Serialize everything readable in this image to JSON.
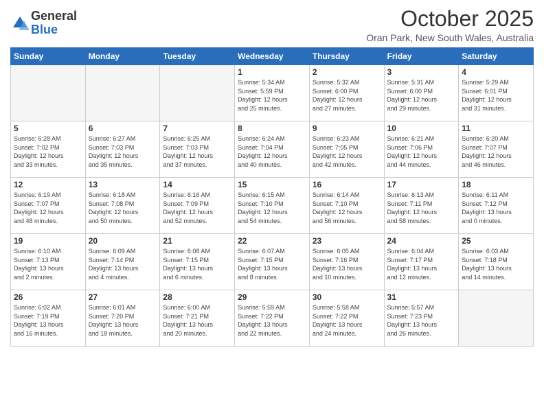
{
  "logo": {
    "general": "General",
    "blue": "Blue"
  },
  "title": "October 2025",
  "location": "Oran Park, New South Wales, Australia",
  "headers": [
    "Sunday",
    "Monday",
    "Tuesday",
    "Wednesday",
    "Thursday",
    "Friday",
    "Saturday"
  ],
  "weeks": [
    [
      {
        "day": "",
        "detail": ""
      },
      {
        "day": "",
        "detail": ""
      },
      {
        "day": "",
        "detail": ""
      },
      {
        "day": "1",
        "detail": "Sunrise: 5:34 AM\nSunset: 5:59 PM\nDaylight: 12 hours\nand 25 minutes."
      },
      {
        "day": "2",
        "detail": "Sunrise: 5:32 AM\nSunset: 6:00 PM\nDaylight: 12 hours\nand 27 minutes."
      },
      {
        "day": "3",
        "detail": "Sunrise: 5:31 AM\nSunset: 6:00 PM\nDaylight: 12 hours\nand 29 minutes."
      },
      {
        "day": "4",
        "detail": "Sunrise: 5:29 AM\nSunset: 6:01 PM\nDaylight: 12 hours\nand 31 minutes."
      }
    ],
    [
      {
        "day": "5",
        "detail": "Sunrise: 6:28 AM\nSunset: 7:02 PM\nDaylight: 12 hours\nand 33 minutes."
      },
      {
        "day": "6",
        "detail": "Sunrise: 6:27 AM\nSunset: 7:03 PM\nDaylight: 12 hours\nand 35 minutes."
      },
      {
        "day": "7",
        "detail": "Sunrise: 6:25 AM\nSunset: 7:03 PM\nDaylight: 12 hours\nand 37 minutes."
      },
      {
        "day": "8",
        "detail": "Sunrise: 6:24 AM\nSunset: 7:04 PM\nDaylight: 12 hours\nand 40 minutes."
      },
      {
        "day": "9",
        "detail": "Sunrise: 6:23 AM\nSunset: 7:05 PM\nDaylight: 12 hours\nand 42 minutes."
      },
      {
        "day": "10",
        "detail": "Sunrise: 6:21 AM\nSunset: 7:06 PM\nDaylight: 12 hours\nand 44 minutes."
      },
      {
        "day": "11",
        "detail": "Sunrise: 6:20 AM\nSunset: 7:07 PM\nDaylight: 12 hours\nand 46 minutes."
      }
    ],
    [
      {
        "day": "12",
        "detail": "Sunrise: 6:19 AM\nSunset: 7:07 PM\nDaylight: 12 hours\nand 48 minutes."
      },
      {
        "day": "13",
        "detail": "Sunrise: 6:18 AM\nSunset: 7:08 PM\nDaylight: 12 hours\nand 50 minutes."
      },
      {
        "day": "14",
        "detail": "Sunrise: 6:16 AM\nSunset: 7:09 PM\nDaylight: 12 hours\nand 52 minutes."
      },
      {
        "day": "15",
        "detail": "Sunrise: 6:15 AM\nSunset: 7:10 PM\nDaylight: 12 hours\nand 54 minutes."
      },
      {
        "day": "16",
        "detail": "Sunrise: 6:14 AM\nSunset: 7:10 PM\nDaylight: 12 hours\nand 56 minutes."
      },
      {
        "day": "17",
        "detail": "Sunrise: 6:13 AM\nSunset: 7:11 PM\nDaylight: 12 hours\nand 58 minutes."
      },
      {
        "day": "18",
        "detail": "Sunrise: 6:11 AM\nSunset: 7:12 PM\nDaylight: 13 hours\nand 0 minutes."
      }
    ],
    [
      {
        "day": "19",
        "detail": "Sunrise: 6:10 AM\nSunset: 7:13 PM\nDaylight: 13 hours\nand 2 minutes."
      },
      {
        "day": "20",
        "detail": "Sunrise: 6:09 AM\nSunset: 7:14 PM\nDaylight: 13 hours\nand 4 minutes."
      },
      {
        "day": "21",
        "detail": "Sunrise: 6:08 AM\nSunset: 7:15 PM\nDaylight: 13 hours\nand 6 minutes."
      },
      {
        "day": "22",
        "detail": "Sunrise: 6:07 AM\nSunset: 7:15 PM\nDaylight: 13 hours\nand 8 minutes."
      },
      {
        "day": "23",
        "detail": "Sunrise: 6:05 AM\nSunset: 7:16 PM\nDaylight: 13 hours\nand 10 minutes."
      },
      {
        "day": "24",
        "detail": "Sunrise: 6:04 AM\nSunset: 7:17 PM\nDaylight: 13 hours\nand 12 minutes."
      },
      {
        "day": "25",
        "detail": "Sunrise: 6:03 AM\nSunset: 7:18 PM\nDaylight: 13 hours\nand 14 minutes."
      }
    ],
    [
      {
        "day": "26",
        "detail": "Sunrise: 6:02 AM\nSunset: 7:19 PM\nDaylight: 13 hours\nand 16 minutes."
      },
      {
        "day": "27",
        "detail": "Sunrise: 6:01 AM\nSunset: 7:20 PM\nDaylight: 13 hours\nand 18 minutes."
      },
      {
        "day": "28",
        "detail": "Sunrise: 6:00 AM\nSunset: 7:21 PM\nDaylight: 13 hours\nand 20 minutes."
      },
      {
        "day": "29",
        "detail": "Sunrise: 5:59 AM\nSunset: 7:22 PM\nDaylight: 13 hours\nand 22 minutes."
      },
      {
        "day": "30",
        "detail": "Sunrise: 5:58 AM\nSunset: 7:22 PM\nDaylight: 13 hours\nand 24 minutes."
      },
      {
        "day": "31",
        "detail": "Sunrise: 5:57 AM\nSunset: 7:23 PM\nDaylight: 13 hours\nand 26 minutes."
      },
      {
        "day": "",
        "detail": ""
      }
    ]
  ]
}
